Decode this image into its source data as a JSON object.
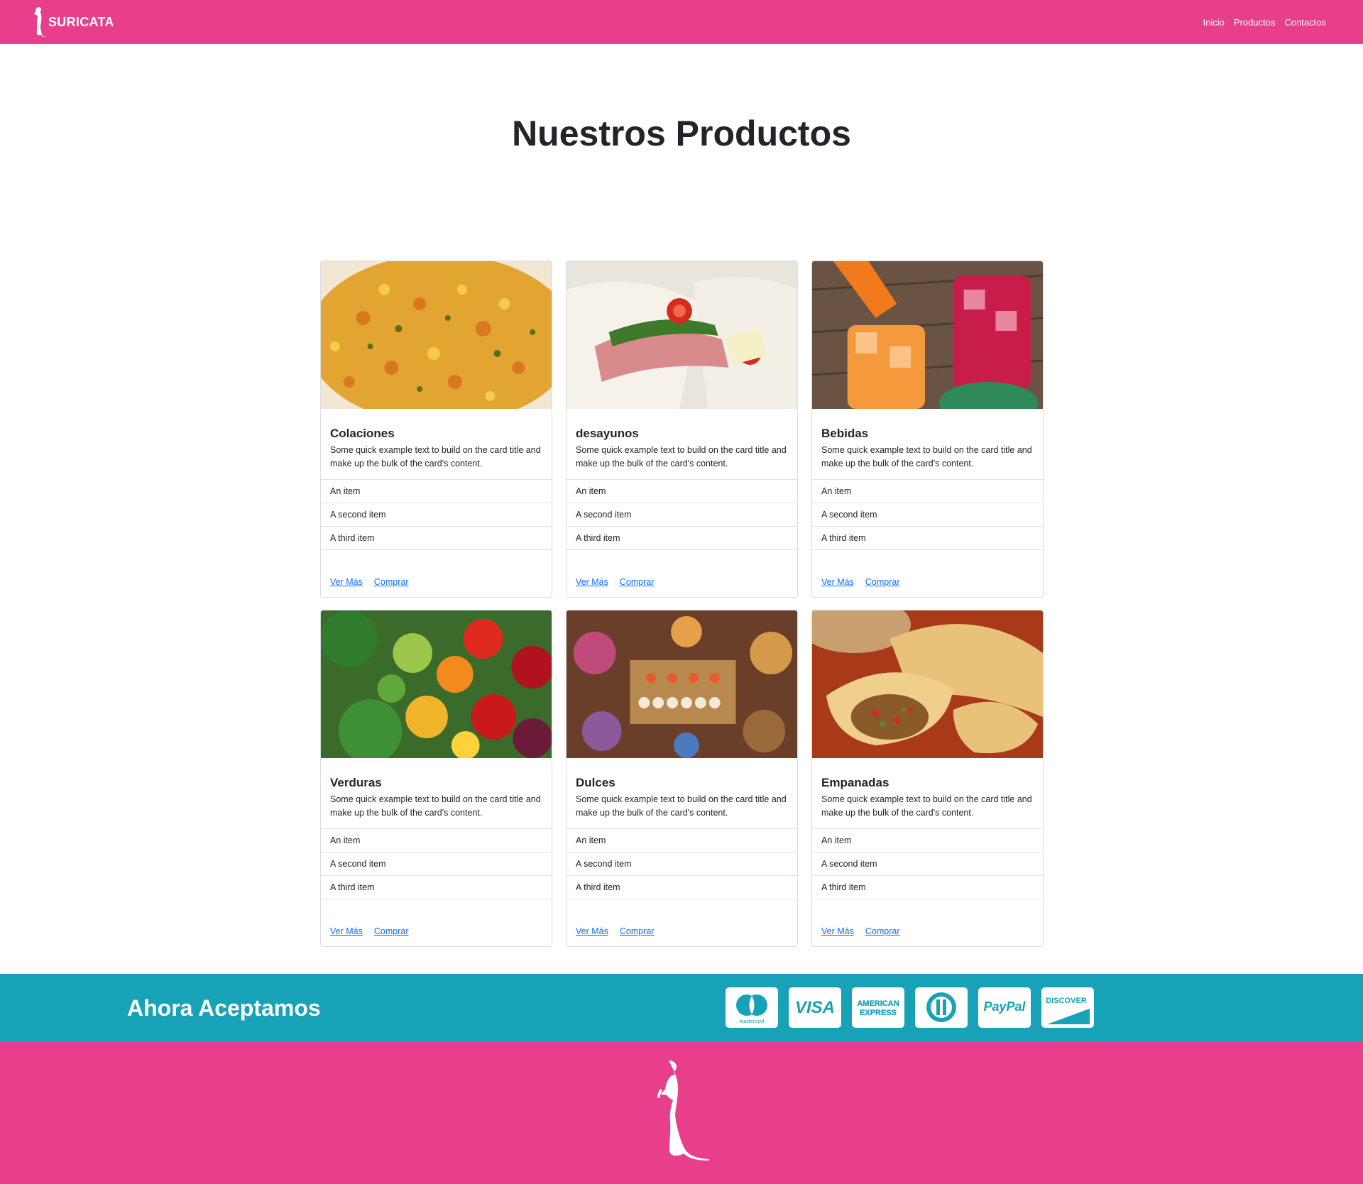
{
  "navbar": {
    "brand": "SURICATA",
    "links": [
      "Inicio",
      "Productos",
      "Contactos"
    ]
  },
  "main": {
    "title": "Nuestros Productos",
    "cards": [
      {
        "title": "Colaciones",
        "text": "Some quick example text to build on the card title and make up the bulk of the card's content.",
        "items": [
          "An item",
          "A second item",
          "A third item"
        ],
        "links": [
          "Ver Más",
          "Comprar"
        ]
      },
      {
        "title": "desayunos",
        "text": "Some quick example text to build on the card title and make up the bulk of the card's content.",
        "items": [
          "An item",
          "A second item",
          "A third item"
        ],
        "links": [
          "Ver Más",
          "Comprar"
        ]
      },
      {
        "title": "Bebidas",
        "text": "Some quick example text to build on the card title and make up the bulk of the card's content.",
        "items": [
          "An item",
          "A second item",
          "A third item"
        ],
        "links": [
          "Ver Más",
          "Comprar"
        ]
      },
      {
        "title": "Verduras",
        "text": "Some quick example text to build on the card title and make up the bulk of the card's content.",
        "items": [
          "An item",
          "A second item",
          "A third item"
        ],
        "links": [
          "Ver Más",
          "Comprar"
        ]
      },
      {
        "title": "Dulces",
        "text": "Some quick example text to build on the card title and make up the bulk of the card's content.",
        "items": [
          "An item",
          "A second item",
          "A third item"
        ],
        "links": [
          "Ver Más",
          "Comprar"
        ]
      },
      {
        "title": "Empanadas",
        "text": "Some quick example text to build on the card title and make up the bulk of the card's content.",
        "items": [
          "An item",
          "A second item",
          "A third item"
        ],
        "links": [
          "Ver Más",
          "Comprar"
        ]
      }
    ]
  },
  "payments": {
    "title": "Ahora Aceptamos",
    "icons": [
      {
        "icon": "mastercard-icon",
        "label": "mastercard"
      },
      {
        "icon": "visa-icon",
        "label": "VISA"
      },
      {
        "icon": "american-express-icon",
        "label": "AMERICAN EXPRESS"
      },
      {
        "icon": "diners-club-icon",
        "label": ""
      },
      {
        "icon": "paypal-icon",
        "label": "PayPal"
      },
      {
        "icon": "discover-icon",
        "label": "DISCOVER"
      }
    ]
  },
  "colors": {
    "brand_pink": "#e83e8c",
    "band_teal": "#17a2b8",
    "link_blue": "#0d6efd",
    "text_dark": "#212529"
  }
}
